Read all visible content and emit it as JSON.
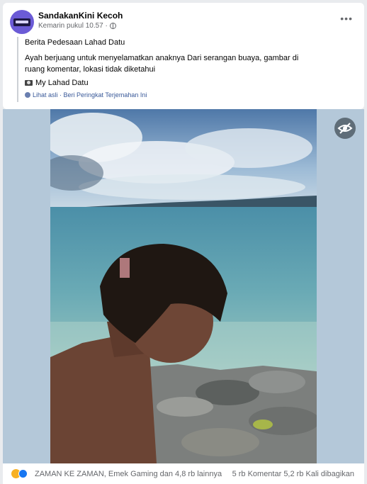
{
  "post": {
    "page_name": "SandakanKini Kecoh",
    "timestamp": "Kemarin pukul 10.57 ·",
    "more_label": "•••",
    "quote": {
      "title": "Berita Pedesaan Lahad Datu",
      "body": "Ayah berjuang untuk menyelamatkan anaknya Dari serangan buaya, gambar di ruang komentar, lokasi tidak diketahui",
      "source": "My Lahad Datu",
      "links": "Lihat asli · Beri Peringkat Terjemahan Ini"
    }
  },
  "footer": {
    "reactors": "ZAMAN KE ZAMAN, Emek Gaming dan 4,8 rb lainnya",
    "stats": "5 rb Komentar  5,2 rb Kali dibagikan"
  },
  "colors": {
    "link": "#385898",
    "like": "#1877f2",
    "sad": "#f7b125"
  },
  "icons": [
    "globe-icon",
    "more-icon",
    "camera-icon",
    "eye-icon",
    "sad-reaction-icon",
    "like-reaction-icon"
  ]
}
